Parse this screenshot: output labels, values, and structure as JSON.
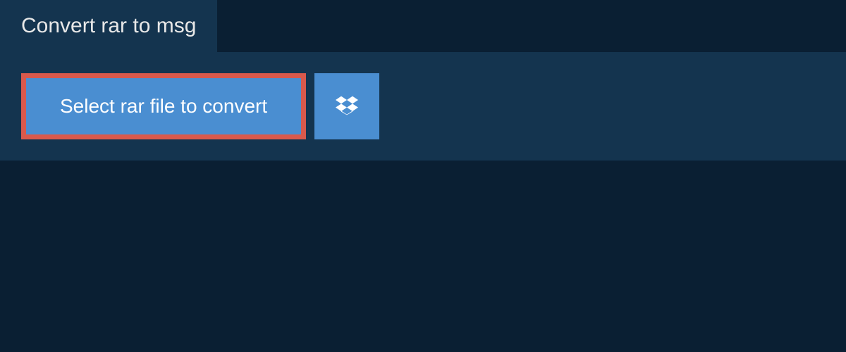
{
  "header": {
    "title": "Convert rar to msg"
  },
  "actions": {
    "select_label": "Select rar file to convert",
    "dropbox_icon": "dropbox"
  },
  "colors": {
    "page_bg": "#0a1f33",
    "panel_bg": "#14344f",
    "button_bg": "#4a8ed1",
    "highlight_border": "#d9594c",
    "text_light": "#e8e8e8"
  }
}
